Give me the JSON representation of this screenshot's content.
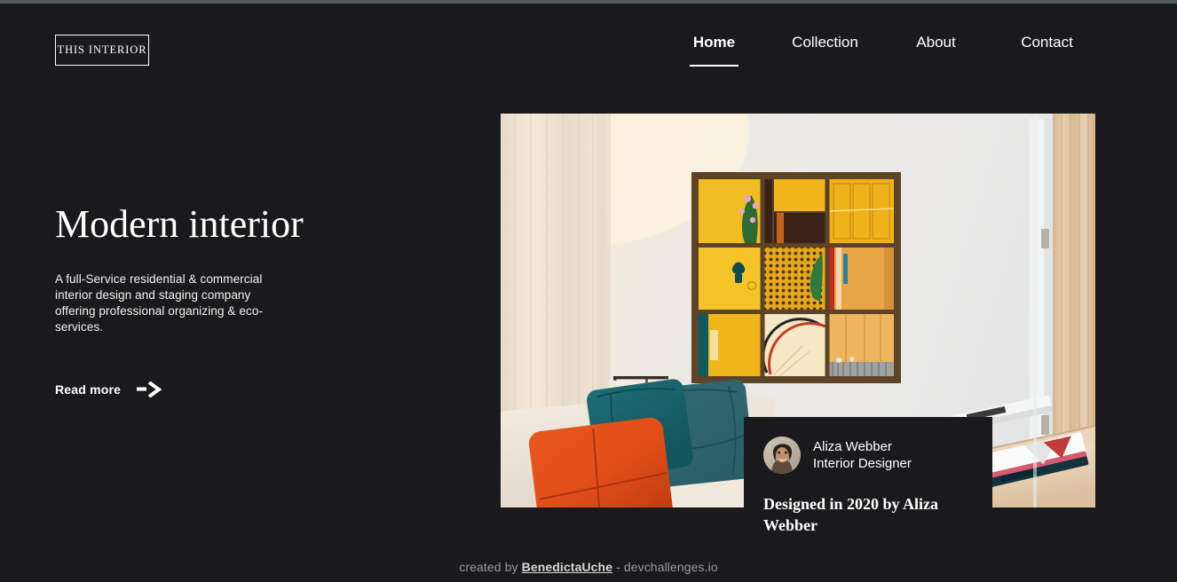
{
  "site": {
    "background_color": "#1a1a1c",
    "text_color": "#ffffff"
  },
  "header": {
    "logo_label": "THIS INTERIOR",
    "nav": [
      {
        "label": "Home",
        "active": true
      },
      {
        "label": "Collection",
        "active": false
      },
      {
        "label": "About",
        "active": false
      },
      {
        "label": "Contact",
        "active": false
      }
    ]
  },
  "hero": {
    "title": "Modern interior",
    "description": "A full-Service residential & commercial interior design and staging company offering professional organizing & eco-services.",
    "cta_label": "Read more",
    "cta_icon": "arrow-right-icon",
    "image_alt": "Modern living room with cream sofa, teal and orange cushions, brass floor lamp and a yellow nine-panel wall artwork"
  },
  "designer_card": {
    "avatar_icon": "avatar-photo",
    "name": "Aliza Webber",
    "role": "Interior Designer",
    "caption": "Designed in 2020 by Aliza Webber"
  },
  "footer": {
    "prefix": "created by ",
    "author": "BenedictaUche",
    "suffix": " - devchallenges.io"
  }
}
